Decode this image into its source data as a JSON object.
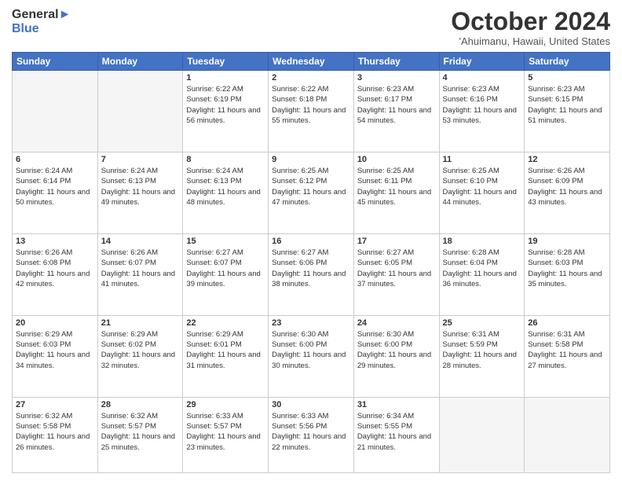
{
  "header": {
    "logo_general": "General",
    "logo_blue": "Blue",
    "title": "October 2024",
    "location": "'Ahuimanu, Hawaii, United States"
  },
  "weekdays": [
    "Sunday",
    "Monday",
    "Tuesday",
    "Wednesday",
    "Thursday",
    "Friday",
    "Saturday"
  ],
  "weeks": [
    [
      {
        "day": "",
        "sunrise": "",
        "sunset": "",
        "daylight": ""
      },
      {
        "day": "",
        "sunrise": "",
        "sunset": "",
        "daylight": ""
      },
      {
        "day": "1",
        "sunrise": "Sunrise: 6:22 AM",
        "sunset": "Sunset: 6:19 PM",
        "daylight": "Daylight: 11 hours and 56 minutes."
      },
      {
        "day": "2",
        "sunrise": "Sunrise: 6:22 AM",
        "sunset": "Sunset: 6:18 PM",
        "daylight": "Daylight: 11 hours and 55 minutes."
      },
      {
        "day": "3",
        "sunrise": "Sunrise: 6:23 AM",
        "sunset": "Sunset: 6:17 PM",
        "daylight": "Daylight: 11 hours and 54 minutes."
      },
      {
        "day": "4",
        "sunrise": "Sunrise: 6:23 AM",
        "sunset": "Sunset: 6:16 PM",
        "daylight": "Daylight: 11 hours and 53 minutes."
      },
      {
        "day": "5",
        "sunrise": "Sunrise: 6:23 AM",
        "sunset": "Sunset: 6:15 PM",
        "daylight": "Daylight: 11 hours and 51 minutes."
      }
    ],
    [
      {
        "day": "6",
        "sunrise": "Sunrise: 6:24 AM",
        "sunset": "Sunset: 6:14 PM",
        "daylight": "Daylight: 11 hours and 50 minutes."
      },
      {
        "day": "7",
        "sunrise": "Sunrise: 6:24 AM",
        "sunset": "Sunset: 6:13 PM",
        "daylight": "Daylight: 11 hours and 49 minutes."
      },
      {
        "day": "8",
        "sunrise": "Sunrise: 6:24 AM",
        "sunset": "Sunset: 6:13 PM",
        "daylight": "Daylight: 11 hours and 48 minutes."
      },
      {
        "day": "9",
        "sunrise": "Sunrise: 6:25 AM",
        "sunset": "Sunset: 6:12 PM",
        "daylight": "Daylight: 11 hours and 47 minutes."
      },
      {
        "day": "10",
        "sunrise": "Sunrise: 6:25 AM",
        "sunset": "Sunset: 6:11 PM",
        "daylight": "Daylight: 11 hours and 45 minutes."
      },
      {
        "day": "11",
        "sunrise": "Sunrise: 6:25 AM",
        "sunset": "Sunset: 6:10 PM",
        "daylight": "Daylight: 11 hours and 44 minutes."
      },
      {
        "day": "12",
        "sunrise": "Sunrise: 6:26 AM",
        "sunset": "Sunset: 6:09 PM",
        "daylight": "Daylight: 11 hours and 43 minutes."
      }
    ],
    [
      {
        "day": "13",
        "sunrise": "Sunrise: 6:26 AM",
        "sunset": "Sunset: 6:08 PM",
        "daylight": "Daylight: 11 hours and 42 minutes."
      },
      {
        "day": "14",
        "sunrise": "Sunrise: 6:26 AM",
        "sunset": "Sunset: 6:07 PM",
        "daylight": "Daylight: 11 hours and 41 minutes."
      },
      {
        "day": "15",
        "sunrise": "Sunrise: 6:27 AM",
        "sunset": "Sunset: 6:07 PM",
        "daylight": "Daylight: 11 hours and 39 minutes."
      },
      {
        "day": "16",
        "sunrise": "Sunrise: 6:27 AM",
        "sunset": "Sunset: 6:06 PM",
        "daylight": "Daylight: 11 hours and 38 minutes."
      },
      {
        "day": "17",
        "sunrise": "Sunrise: 6:27 AM",
        "sunset": "Sunset: 6:05 PM",
        "daylight": "Daylight: 11 hours and 37 minutes."
      },
      {
        "day": "18",
        "sunrise": "Sunrise: 6:28 AM",
        "sunset": "Sunset: 6:04 PM",
        "daylight": "Daylight: 11 hours and 36 minutes."
      },
      {
        "day": "19",
        "sunrise": "Sunrise: 6:28 AM",
        "sunset": "Sunset: 6:03 PM",
        "daylight": "Daylight: 11 hours and 35 minutes."
      }
    ],
    [
      {
        "day": "20",
        "sunrise": "Sunrise: 6:29 AM",
        "sunset": "Sunset: 6:03 PM",
        "daylight": "Daylight: 11 hours and 34 minutes."
      },
      {
        "day": "21",
        "sunrise": "Sunrise: 6:29 AM",
        "sunset": "Sunset: 6:02 PM",
        "daylight": "Daylight: 11 hours and 32 minutes."
      },
      {
        "day": "22",
        "sunrise": "Sunrise: 6:29 AM",
        "sunset": "Sunset: 6:01 PM",
        "daylight": "Daylight: 11 hours and 31 minutes."
      },
      {
        "day": "23",
        "sunrise": "Sunrise: 6:30 AM",
        "sunset": "Sunset: 6:00 PM",
        "daylight": "Daylight: 11 hours and 30 minutes."
      },
      {
        "day": "24",
        "sunrise": "Sunrise: 6:30 AM",
        "sunset": "Sunset: 6:00 PM",
        "daylight": "Daylight: 11 hours and 29 minutes."
      },
      {
        "day": "25",
        "sunrise": "Sunrise: 6:31 AM",
        "sunset": "Sunset: 5:59 PM",
        "daylight": "Daylight: 11 hours and 28 minutes."
      },
      {
        "day": "26",
        "sunrise": "Sunrise: 6:31 AM",
        "sunset": "Sunset: 5:58 PM",
        "daylight": "Daylight: 11 hours and 27 minutes."
      }
    ],
    [
      {
        "day": "27",
        "sunrise": "Sunrise: 6:32 AM",
        "sunset": "Sunset: 5:58 PM",
        "daylight": "Daylight: 11 hours and 26 minutes."
      },
      {
        "day": "28",
        "sunrise": "Sunrise: 6:32 AM",
        "sunset": "Sunset: 5:57 PM",
        "daylight": "Daylight: 11 hours and 25 minutes."
      },
      {
        "day": "29",
        "sunrise": "Sunrise: 6:33 AM",
        "sunset": "Sunset: 5:57 PM",
        "daylight": "Daylight: 11 hours and 23 minutes."
      },
      {
        "day": "30",
        "sunrise": "Sunrise: 6:33 AM",
        "sunset": "Sunset: 5:56 PM",
        "daylight": "Daylight: 11 hours and 22 minutes."
      },
      {
        "day": "31",
        "sunrise": "Sunrise: 6:34 AM",
        "sunset": "Sunset: 5:55 PM",
        "daylight": "Daylight: 11 hours and 21 minutes."
      },
      {
        "day": "",
        "sunrise": "",
        "sunset": "",
        "daylight": ""
      },
      {
        "day": "",
        "sunrise": "",
        "sunset": "",
        "daylight": ""
      }
    ]
  ]
}
